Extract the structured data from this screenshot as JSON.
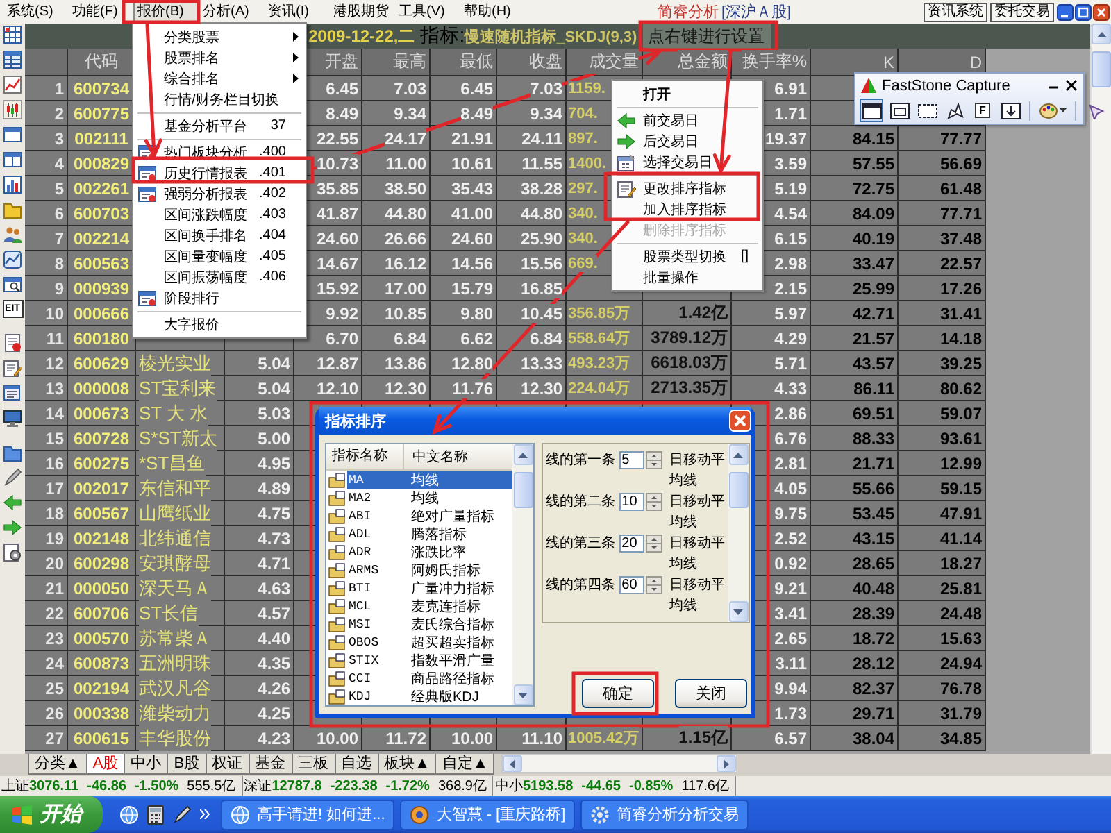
{
  "menu_bar": {
    "items": [
      {
        "label": "系统(S)",
        "selected": false
      },
      {
        "label": "功能(F)",
        "selected": false
      },
      {
        "label": "报价(B)",
        "selected": true
      },
      {
        "label": "分析(A)",
        "selected": false
      },
      {
        "label": "资讯(I)",
        "selected": false
      },
      {
        "label": "港股期货",
        "selected": false
      },
      {
        "label": "工具(V)",
        "selected": false
      },
      {
        "label": "帮助(H)",
        "selected": false
      }
    ],
    "app_name": "简睿分析",
    "market": "[深沪Ａ股]",
    "buttons": [
      "资讯系统",
      "委托交易"
    ]
  },
  "left_toolbar": {
    "text_button": "EIT"
  },
  "report_header": {
    "date": "2009-12-22,二",
    "indicator_label": "指标:",
    "indicator": "慢速随机指标_SKDJ(9,3)",
    "hint": "点右键进行设置"
  },
  "table": {
    "headers": {
      "code": "代码",
      "open": "开盘",
      "high": "最高",
      "low": "最低",
      "close": "收盘",
      "volume": "成交量",
      "amount": "总金额",
      "turnover": "换手率%",
      "k": "K",
      "d": "D"
    },
    "rows": [
      {
        "column_1": "1",
        "code": "600734",
        "open": "6.45",
        "high": "7.03",
        "low": "6.45",
        "close": "7.03",
        "volume": "1159.",
        "turnover": "6.91"
      },
      {
        "column_1": "2",
        "code": "600775",
        "open": "8.49",
        "high": "9.34",
        "low": "8.49",
        "close": "9.34",
        "volume": "704.",
        "turnover": "1.71"
      },
      {
        "column_1": "3",
        "code": "002111",
        "open": "22.55",
        "high": "24.17",
        "low": "21.91",
        "close": "24.11",
        "volume": "897.",
        "turnover": "19.37",
        "k": "84.15",
        "d": "77.77"
      },
      {
        "column_1": "4",
        "code": "000829",
        "open": "10.73",
        "high": "11.00",
        "low": "10.61",
        "close": "11.55",
        "volume": "1400.",
        "turnover": "3.59",
        "k": "57.55",
        "d": "56.69"
      },
      {
        "column_1": "5",
        "code": "002261",
        "open": "35.85",
        "high": "38.50",
        "low": "35.43",
        "close": "38.28",
        "volume": "297.",
        "turnover": "5.19",
        "k": "72.75",
        "d": "61.48"
      },
      {
        "column_1": "6",
        "code": "600703",
        "open": "41.87",
        "high": "44.80",
        "low": "41.00",
        "close": "44.80",
        "volume": "340.",
        "turnover": "4.54",
        "k": "84.09",
        "d": "77.71"
      },
      {
        "column_1": "7",
        "code": "002214",
        "open": "24.60",
        "high": "26.66",
        "low": "24.60",
        "close": "25.90",
        "volume": "340.",
        "turnover": "6.15",
        "k": "40.19",
        "d": "37.48"
      },
      {
        "column_1": "8",
        "code": "600563",
        "open": "14.67",
        "high": "16.12",
        "low": "14.56",
        "close": "15.56",
        "volume": "669.",
        "turnover": "2.98",
        "k": "33.47",
        "d": "22.57"
      },
      {
        "column_1": "9",
        "code": "000939",
        "open": "15.92",
        "high": "17.00",
        "low": "15.79",
        "close": "16.85",
        "turnover": "2.15",
        "k": "25.99",
        "d": "17.26"
      },
      {
        "column_1": "10",
        "code": "000666",
        "open": "9.92",
        "high": "10.85",
        "low": "9.80",
        "close": "10.45",
        "volume": "356.85万",
        "amount": "1.42亿",
        "turnover": "5.97",
        "k": "42.71",
        "d": "31.41"
      },
      {
        "column_1": "11",
        "code": "600180",
        "open": "6.70",
        "high": "6.84",
        "low": "6.62",
        "close": "6.84",
        "volume": "558.64万",
        "amount": "3789.12万",
        "turnover": "4.29",
        "k": "21.57",
        "d": "14.18"
      },
      {
        "column_1": "12",
        "code": "600629",
        "column_3": "棱光实业",
        "column_4": "5.04",
        "open": "12.87",
        "high": "13.86",
        "low": "12.80",
        "close": "13.33",
        "volume": "493.23万",
        "amount": "6618.03万",
        "turnover": "5.71",
        "k": "43.57",
        "d": "39.25"
      },
      {
        "column_1": "13",
        "code": "000008",
        "column_3": "ST宝利来",
        "column_4": "5.04",
        "open": "12.10",
        "high": "12.30",
        "low": "11.76",
        "close": "12.30",
        "volume": "224.04万",
        "amount": "2713.35万",
        "turnover": "4.33",
        "k": "86.11",
        "d": "80.62"
      },
      {
        "column_1": "14",
        "code": "000673",
        "column_3": "ST 大 水",
        "column_4": "5.03",
        "turnover": "2.86",
        "k": "69.51",
        "d": "59.07"
      },
      {
        "column_1": "15",
        "code": "600728",
        "column_3": "S*ST新太",
        "column_4": "5.00",
        "turnover": "6.76",
        "k": "88.33",
        "d": "93.61"
      },
      {
        "column_1": "16",
        "code": "600275",
        "column_3": "*ST昌鱼",
        "column_4": "4.95",
        "turnover": "2.81",
        "k": "21.71",
        "d": "12.99"
      },
      {
        "column_1": "17",
        "code": "002017",
        "column_3": "东信和平",
        "column_4": "4.89",
        "turnover": "4.05",
        "k": "55.66",
        "d": "59.15"
      },
      {
        "column_1": "18",
        "code": "600567",
        "column_3": "山鹰纸业",
        "column_4": "4.75",
        "turnover": "9.75",
        "k": "53.45",
        "d": "47.91"
      },
      {
        "column_1": "19",
        "code": "002148",
        "column_3": "北纬通信",
        "column_4": "4.73",
        "turnover": "2.52",
        "k": "43.15",
        "d": "41.14"
      },
      {
        "column_1": "20",
        "code": "600298",
        "column_3": "安琪酵母",
        "column_4": "4.71",
        "turnover": "0.92",
        "k": "28.65",
        "d": "18.27"
      },
      {
        "column_1": "21",
        "code": "000050",
        "column_3": "深天马Ａ",
        "column_4": "4.63",
        "turnover": "9.21",
        "k": "40.48",
        "d": "25.81"
      },
      {
        "column_1": "22",
        "code": "600706",
        "column_3": "ST长信",
        "column_4": "4.57",
        "turnover": "3.41",
        "k": "28.39",
        "d": "24.48"
      },
      {
        "column_1": "23",
        "code": "000570",
        "column_3": "苏常柴Ａ",
        "column_4": "4.40",
        "turnover": "2.65",
        "k": "18.72",
        "d": "15.63"
      },
      {
        "column_1": "24",
        "code": "600873",
        "column_3": "五洲明珠",
        "column_4": "4.35",
        "turnover": "3.11",
        "k": "28.12",
        "d": "24.94"
      },
      {
        "column_1": "25",
        "code": "002194",
        "column_3": "武汉凡谷",
        "column_4": "4.26",
        "turnover": "9.94",
        "k": "82.37",
        "d": "76.78"
      },
      {
        "column_1": "26",
        "code": "000338",
        "column_3": "潍柴动力",
        "column_4": "4.25",
        "turnover": "1.73",
        "k": "29.71",
        "d": "31.79"
      },
      {
        "column_1": "27",
        "code": "600615",
        "column_3": "丰华股份",
        "column_4": "4.23",
        "open": "10.00",
        "high": "11.72",
        "low": "10.00",
        "close": "11.10",
        "volume": "1005.42万",
        "amount": "1.15亿",
        "turnover": "6.57",
        "k": "38.04",
        "d": "34.85"
      }
    ]
  },
  "quote_menu": {
    "items": [
      {
        "kind": "submenu",
        "label": "分类股票"
      },
      {
        "kind": "submenu",
        "label": "股票排名"
      },
      {
        "kind": "submenu",
        "label": "综合排名"
      },
      {
        "kind": "plain",
        "label": "行情/财务栏目切换"
      },
      {
        "kind": "separator"
      },
      {
        "kind": "plain",
        "label": "基金分析平台",
        "shortcut": "37"
      },
      {
        "kind": "separator"
      },
      {
        "kind": "report",
        "label": "热门板块分析",
        "shortcut": ".400"
      },
      {
        "kind": "report",
        "label": "历史行情报表",
        "shortcut": ".401"
      },
      {
        "kind": "report",
        "label": "强弱分析报表",
        "shortcut": ".402"
      },
      {
        "kind": "plain",
        "label": "区间涨跌幅度",
        "shortcut": ".403"
      },
      {
        "kind": "plain",
        "label": "区间换手排名",
        "shortcut": ".404"
      },
      {
        "kind": "plain",
        "label": "区间量变幅度",
        "shortcut": ".405"
      },
      {
        "kind": "plain",
        "label": "区间振荡幅度",
        "shortcut": ".406"
      },
      {
        "kind": "report",
        "label": "阶段排行"
      },
      {
        "kind": "separator"
      },
      {
        "kind": "plain",
        "label": "大字报价"
      }
    ]
  },
  "context_menu": {
    "items": [
      {
        "kind": "plain",
        "label": "打开",
        "default": true,
        "disabled": false
      },
      {
        "kind": "separator"
      },
      {
        "kind": "back",
        "label": "前交易日",
        "default": false,
        "disabled": false
      },
      {
        "kind": "forward",
        "label": "后交易日",
        "default": false,
        "disabled": false
      },
      {
        "kind": "calendar",
        "label": "选择交易日",
        "default": false,
        "disabled": false
      },
      {
        "kind": "separator"
      },
      {
        "kind": "edit",
        "label": "更改排序指标",
        "default": false,
        "disabled": false
      },
      {
        "kind": "plain",
        "label": "加入排序指标",
        "default": false,
        "disabled": false
      },
      {
        "kind": "plain",
        "label": "删除排序指标",
        "default": false,
        "disabled": true
      },
      {
        "kind": "separator"
      },
      {
        "kind": "plain",
        "label": "股票类型切换",
        "shortcut": "[]",
        "default": false,
        "disabled": false
      },
      {
        "kind": "plain",
        "label": "批量操作",
        "default": false,
        "disabled": false
      }
    ]
  },
  "capture_toolbar": {
    "title": "FastStone Capture",
    "tools": [
      {
        "selected": true
      },
      {
        "selected": false
      },
      {
        "selected": false
      },
      {
        "selected": false
      },
      {
        "selected": false,
        "label": "F"
      },
      {
        "selected": false
      },
      {
        "selected": false
      },
      {
        "selected": false
      }
    ]
  },
  "dialog": {
    "title": "指标排序",
    "list": {
      "columns": [
        "指标名称",
        "中文名称"
      ],
      "rows": [
        {
          "code": "MA",
          "name": "均线",
          "selected": true
        },
        {
          "code": "MA2",
          "name": "均线",
          "selected": false
        },
        {
          "code": "ABI",
          "name": "绝对广量指标",
          "selected": false
        },
        {
          "code": "ADL",
          "name": "腾落指标",
          "selected": false
        },
        {
          "code": "ADR",
          "name": "涨跌比率",
          "selected": false
        },
        {
          "code": "ARMS",
          "name": "阿姆氏指标",
          "selected": false
        },
        {
          "code": "BTI",
          "name": "广量冲力指标",
          "selected": false
        },
        {
          "code": "MCL",
          "name": "麦克连指标",
          "selected": false
        },
        {
          "code": "MSI",
          "name": "麦氏综合指标",
          "selected": false
        },
        {
          "code": "OBOS",
          "name": "超买超卖指标",
          "selected": false
        },
        {
          "code": "STIX",
          "name": "指数平滑广量",
          "selected": false
        },
        {
          "code": "CCI",
          "name": "商品路径指标",
          "selected": false
        },
        {
          "code": "KDJ",
          "name": "经典版KDJ",
          "selected": false
        }
      ]
    },
    "params": [
      {
        "label": "线的第一条",
        "value": "5",
        "suffix": "日移动平均线"
      },
      {
        "label": "线的第二条",
        "value": "10",
        "suffix": "日移动平均线"
      },
      {
        "label": "线的第三条",
        "value": "20",
        "suffix": "日移动平均线"
      },
      {
        "label": "线的第四条",
        "value": "60",
        "suffix": "日移动平均线"
      }
    ],
    "buttons": [
      "确定",
      "关闭"
    ]
  },
  "tabs": [
    {
      "label": "分类▲",
      "selected": false
    },
    {
      "label": "A股",
      "selected": true
    },
    {
      "label": "中小",
      "selected": false
    },
    {
      "label": "B股",
      "selected": false
    },
    {
      "label": "权证",
      "selected": false
    },
    {
      "label": "基金",
      "selected": false
    },
    {
      "label": "三板",
      "selected": false
    },
    {
      "label": "自选",
      "selected": false
    },
    {
      "label": "板块▲",
      "selected": false
    },
    {
      "label": "自定▲",
      "selected": false
    }
  ],
  "status_bar": {
    "indices": [
      {
        "name": "上证",
        "value": "3076.11",
        "change": "-46.86",
        "percent": "-1.50%",
        "amount": "555.5亿",
        "falling": true
      },
      {
        "name": "深证",
        "value": "12787.8",
        "change": "-223.38",
        "percent": "-1.72%",
        "amount": "368.9亿",
        "falling": true
      },
      {
        "name": "中小",
        "value": "5193.58",
        "change": "-44.65",
        "percent": "-0.85%",
        "amount": "117.6亿",
        "falling": true
      }
    ]
  },
  "taskbar": {
    "start": "开始",
    "tasks": [
      "高手请进! 如何进...",
      "大智慧 - [重庆路桥]",
      "简睿分析分析交易"
    ]
  }
}
